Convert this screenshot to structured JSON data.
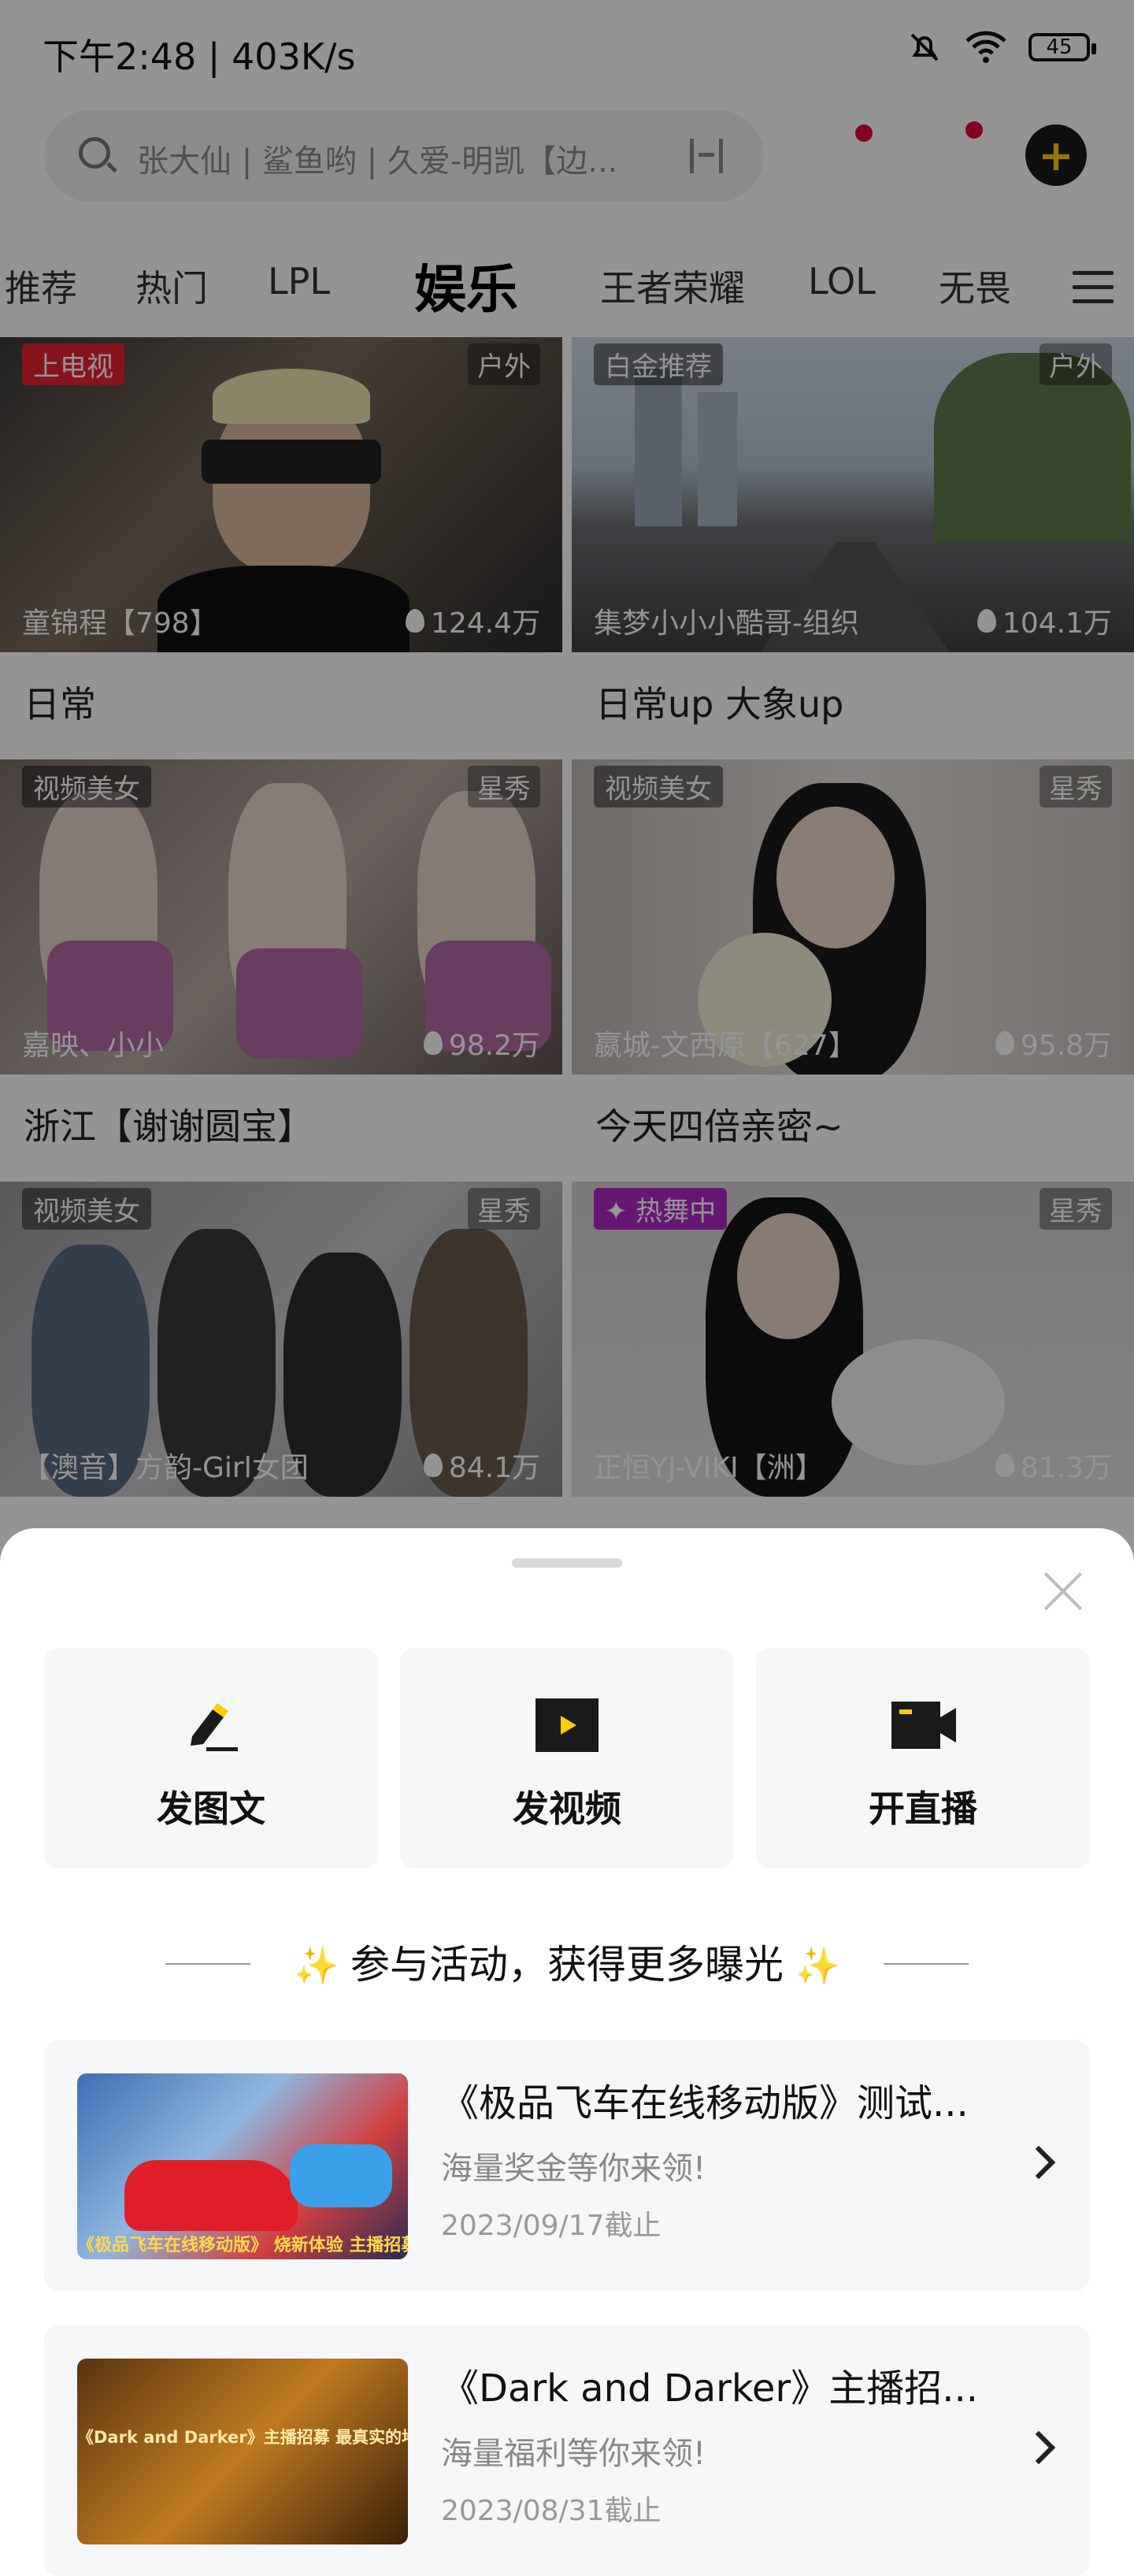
{
  "status_bar": {
    "time": "下午2:48 | 403K/s",
    "battery": "45"
  },
  "search": {
    "placeholder": "张大仙 | 鲨鱼哟 | 久爱-明凯【边..."
  },
  "tabs": [
    {
      "label": "推荐"
    },
    {
      "label": "热门"
    },
    {
      "label": "LPL"
    },
    {
      "label": "娱乐",
      "active": true
    },
    {
      "label": "王者荣耀"
    },
    {
      "label": "LOL"
    },
    {
      "label": "无畏"
    }
  ],
  "cards": [
    {
      "badge_left": "上电视",
      "badge_right": "户外",
      "streamer": "童锦程【798】",
      "viewers": "124.4万",
      "title": "日常"
    },
    {
      "badge_left": "白金推荐",
      "badge_right": "户外",
      "streamer": "集梦小小小酷哥-组织",
      "viewers": "104.1万",
      "title": "日常up 大象up"
    },
    {
      "badge_left": "视频美女",
      "badge_right": "星秀",
      "streamer": "嘉映、小小",
      "viewers": "98.2万",
      "title": "浙江【谢谢圆宝】"
    },
    {
      "badge_left": "视频美女",
      "badge_right": "星秀",
      "streamer": "嬴城-文西原【627】",
      "viewers": "95.8万",
      "title": "今天四倍亲密~"
    },
    {
      "badge_left": "视频美女",
      "badge_right": "星秀",
      "streamer": "【澳音】方韵-Girl女团",
      "viewers": "84.1万",
      "title": ""
    },
    {
      "badge_left": "热舞中",
      "badge_right": "星秀",
      "streamer": "正恒YJ-VIKI【洲】",
      "viewers": "81.3万",
      "title": ""
    }
  ],
  "sheet": {
    "actions": [
      {
        "label": "发图文",
        "icon": "pen-icon"
      },
      {
        "label": "发视频",
        "icon": "video-play-icon"
      },
      {
        "label": "开直播",
        "icon": "camera-icon"
      }
    ],
    "section_title": "参与活动，获得更多曝光",
    "activities": [
      {
        "title": "《极品飞车在线移动版》测试...",
        "subtitle": "海量奖金等你来领!",
        "date": "2023/09/17截止",
        "thumb_text": "《极品飞车在线移动版》 烧新体验 主播招募"
      },
      {
        "title": "《Dark and Darker》主播招...",
        "subtitle": "海量福利等你来领!",
        "date": "2023/08/31截止",
        "thumb_text": "《Dark and Darker》主播招募 最真实的地牢生存"
      }
    ]
  },
  "colors": {
    "accent": "#ffcc00",
    "red_dot": "#e4003a",
    "tv_badge": "#e8242f",
    "dance_badge": "#b028c8"
  }
}
